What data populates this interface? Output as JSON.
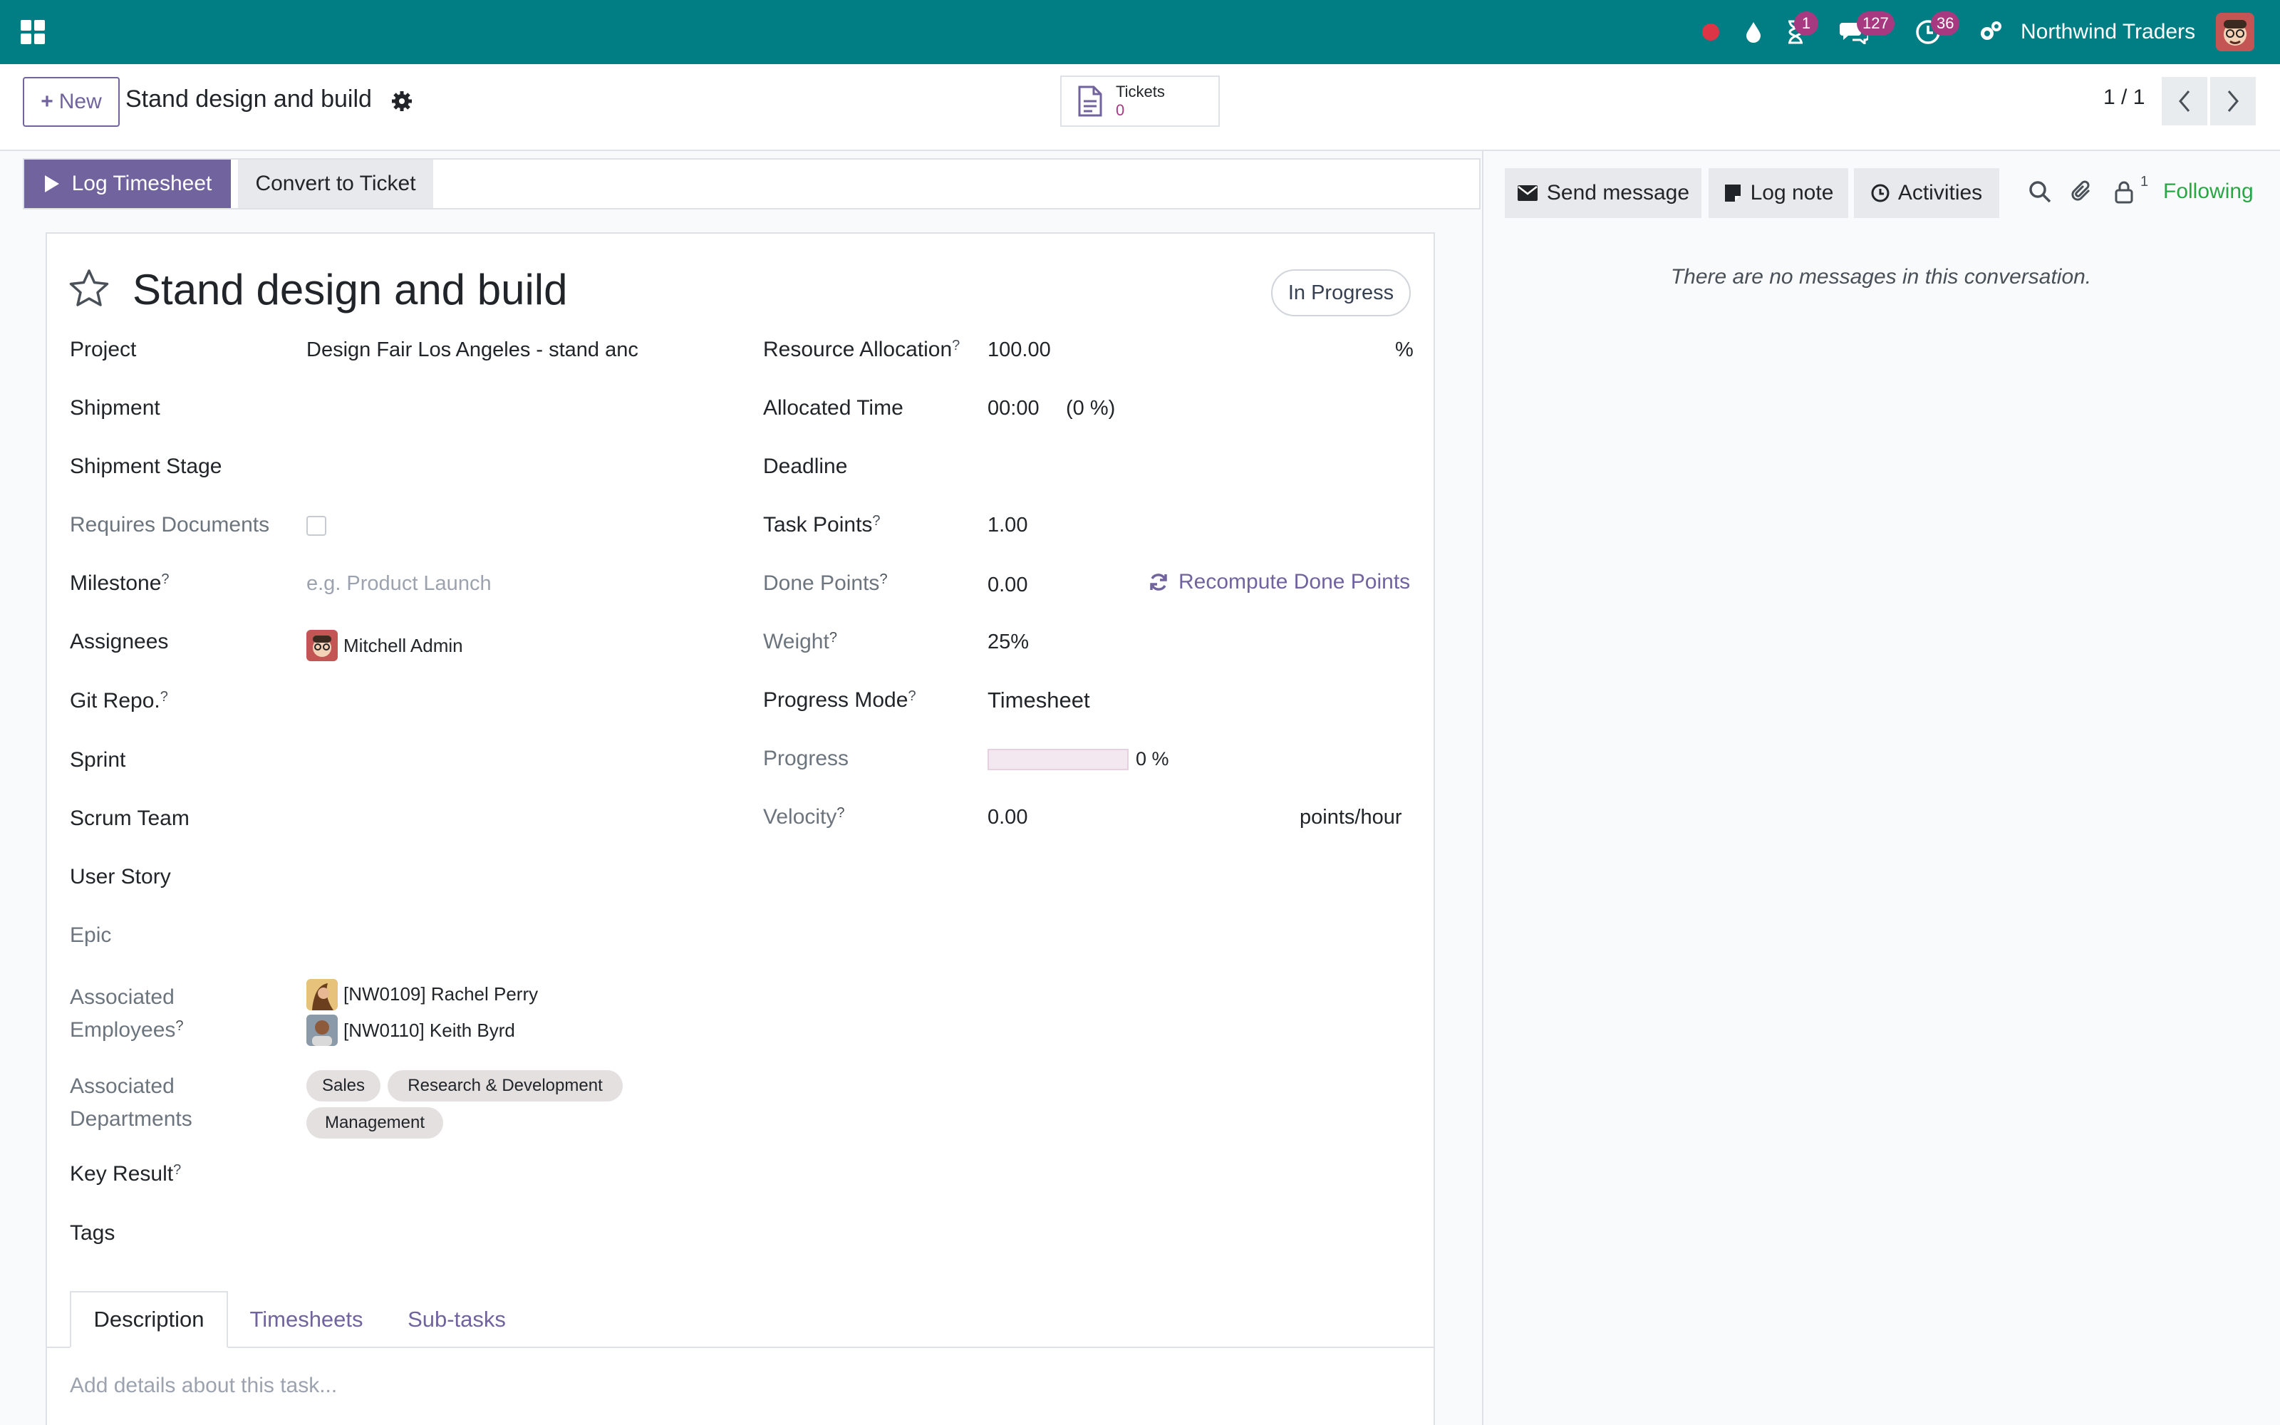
{
  "navbar": {
    "company": "Northwind Traders",
    "badges": {
      "activities": "1",
      "messages": "127",
      "timer": "36"
    }
  },
  "control_panel": {
    "new_label": "New",
    "breadcrumb": "Stand design and build",
    "smart_button": {
      "label": "Tickets",
      "count": "0"
    },
    "pager": "1 / 1"
  },
  "statusbar": {
    "log_timesheet": "Log Timesheet",
    "convert_ticket": "Convert to Ticket"
  },
  "record": {
    "title": "Stand design and build",
    "state": "In Progress",
    "left_fields": {
      "project": {
        "label": "Project",
        "value": "Design Fair Los Angeles - stand anc"
      },
      "shipment": {
        "label": "Shipment"
      },
      "shipment_stage": {
        "label": "Shipment Stage"
      },
      "requires_documents": {
        "label": "Requires Documents"
      },
      "milestone": {
        "label": "Milestone",
        "placeholder": "e.g. Product Launch"
      },
      "assignees": {
        "label": "Assignees",
        "value": "Mitchell Admin"
      },
      "git_repo": {
        "label": "Git Repo."
      },
      "sprint": {
        "label": "Sprint"
      },
      "scrum_team": {
        "label": "Scrum Team"
      },
      "user_story": {
        "label": "User Story"
      },
      "epic": {
        "label": "Epic"
      },
      "associated_employees": {
        "label_line1": "Associated",
        "label_line2": "Employees",
        "values": [
          "[NW0109] Rachel Perry",
          "[NW0110] Keith Byrd"
        ]
      },
      "associated_departments": {
        "label_line1": "Associated",
        "label_line2": "Departments",
        "tags": [
          "Sales",
          "Research & Development",
          "Management"
        ]
      },
      "key_result": {
        "label": "Key Result"
      },
      "tags": {
        "label": "Tags"
      }
    },
    "right_fields": {
      "resource_allocation": {
        "label": "Resource Allocation",
        "value": "100.00",
        "unit": "%"
      },
      "allocated_time": {
        "label": "Allocated Time",
        "value": "00:00",
        "percent": "(0 %)"
      },
      "deadline": {
        "label": "Deadline"
      },
      "task_points": {
        "label": "Task Points",
        "value": "1.00"
      },
      "done_points": {
        "label": "Done Points",
        "value": "0.00",
        "action": "Recompute Done Points"
      },
      "weight": {
        "label": "Weight",
        "value": "25%"
      },
      "progress_mode": {
        "label": "Progress Mode",
        "value": "Timesheet"
      },
      "progress": {
        "label": "Progress",
        "value": 0,
        "text": "0 %"
      },
      "velocity": {
        "label": "Velocity",
        "value": "0.00",
        "unit": "points/hour"
      }
    },
    "help_mark": "?"
  },
  "notebook": {
    "tabs": [
      "Description",
      "Timesheets",
      "Sub-tasks"
    ],
    "description_placeholder": "Add details about this task..."
  },
  "chatter": {
    "send_message": "Send message",
    "log_note": "Log note",
    "activities": "Activities",
    "followers_count": "1",
    "following": "Following",
    "empty": "There are no messages in this conversation."
  },
  "colors": {
    "navbar": "#017e84",
    "primary": "#71639e",
    "badge": "#a73980",
    "following": "#28a745",
    "record_indicator": "#dc3545"
  }
}
